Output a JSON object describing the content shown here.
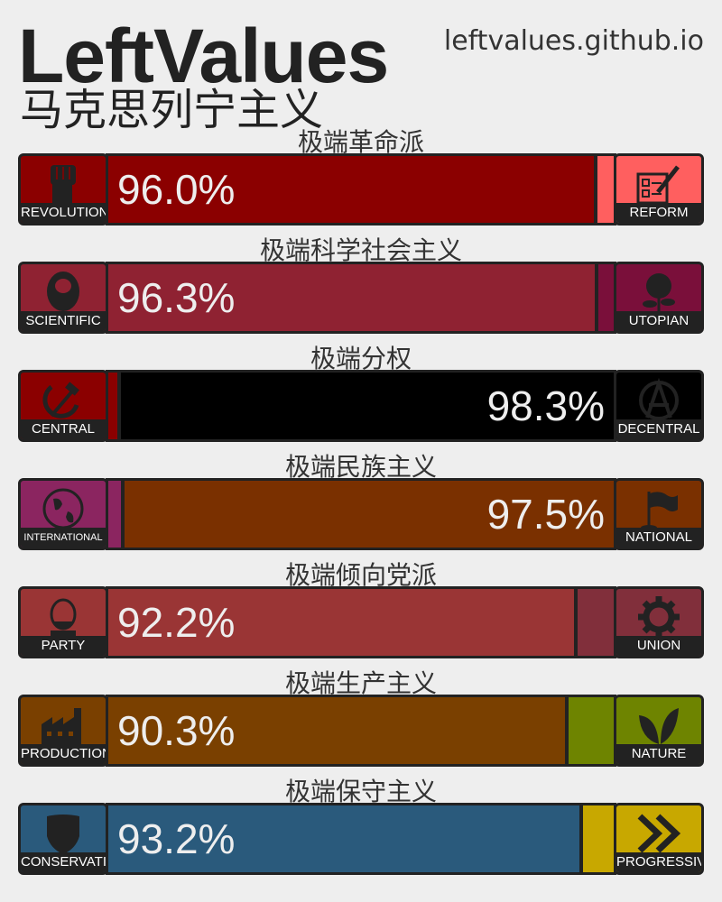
{
  "header": {
    "title": "LeftValues",
    "subtitle": "马克思列宁主义",
    "url": "leftvalues.github.io"
  },
  "axes": [
    {
      "label": "极端革命派",
      "left": {
        "name": "REVOLUTION",
        "icon": "raised-fist-icon",
        "color": "#8b0000"
      },
      "right": {
        "name": "REFORM",
        "icon": "ballot-icon",
        "color": "#ff5f5f"
      },
      "value": 96.0,
      "percent_text": "96.0%",
      "dominant": "left"
    },
    {
      "label": "极端科学社会主义",
      "left": {
        "name": "SCIENTIFIC",
        "icon": "marx-portrait-icon",
        "color": "#8f2232"
      },
      "right": {
        "name": "UTOPIAN",
        "icon": "rose-icon",
        "color": "#7a0f3a"
      },
      "value": 96.3,
      "percent_text": "96.3%",
      "dominant": "left"
    },
    {
      "label": "极端分权",
      "left": {
        "name": "CENTRAL",
        "icon": "hammer-sickle-icon",
        "color": "#8b0000"
      },
      "right": {
        "name": "DECENTRAL",
        "icon": "anarchy-icon",
        "color": "#000000"
      },
      "value": 98.3,
      "percent_text": "98.3%",
      "dominant": "right"
    },
    {
      "label": "极端民族主义",
      "left": {
        "name": "INTERNATIONAL",
        "icon": "globe-icon",
        "color": "#8b2560"
      },
      "right": {
        "name": "NATIONAL",
        "icon": "flag-icon",
        "color": "#7a3000"
      },
      "value": 97.5,
      "percent_text": "97.5%",
      "dominant": "right"
    },
    {
      "label": "极端倾向党派",
      "left": {
        "name": "PARTY",
        "icon": "lenin-portrait-icon",
        "color": "#9a3535"
      },
      "right": {
        "name": "UNION",
        "icon": "gear-icon",
        "color": "#812f3b"
      },
      "value": 92.2,
      "percent_text": "92.2%",
      "dominant": "left"
    },
    {
      "label": "极端生产主义",
      "left": {
        "name": "PRODUCTION",
        "icon": "factory-icon",
        "color": "#7a4000"
      },
      "right": {
        "name": "NATURE",
        "icon": "leaves-icon",
        "color": "#6e8400"
      },
      "value": 90.3,
      "percent_text": "90.3%",
      "dominant": "left"
    },
    {
      "label": "极端保守主义",
      "left": {
        "name": "CONSERVATIVE",
        "icon": "shield-icon",
        "color": "#2a5a7c"
      },
      "right": {
        "name": "PROGRESSIVE",
        "icon": "double-chevron-right-icon",
        "color": "#c8a800"
      },
      "value": 93.2,
      "percent_text": "93.2%",
      "dominant": "left"
    }
  ]
}
